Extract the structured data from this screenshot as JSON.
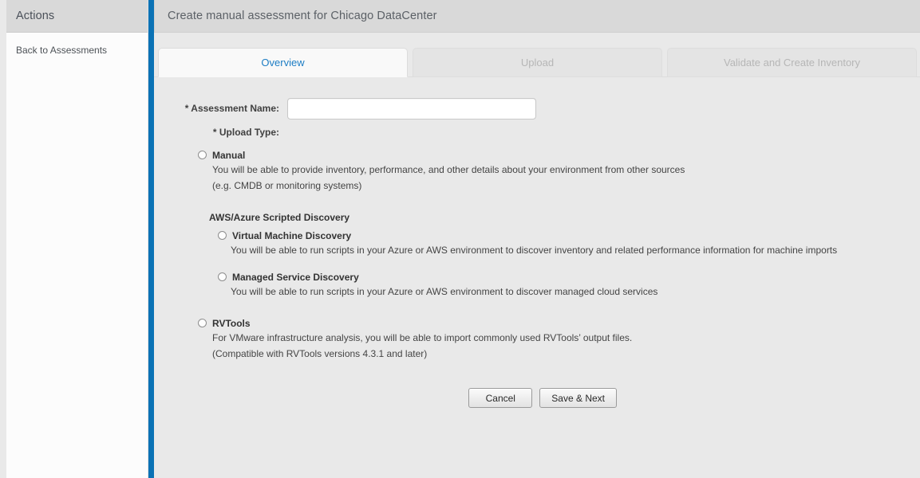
{
  "sidebar": {
    "header_title": "Actions",
    "links": [
      {
        "label": "Back to Assessments"
      }
    ]
  },
  "header": {
    "title": "Create manual assessment for Chicago DataCenter"
  },
  "tabs": [
    {
      "label": "Overview",
      "state": "active"
    },
    {
      "label": "Upload",
      "state": "disabled"
    },
    {
      "label": "Validate and Create Inventory",
      "state": "disabled"
    }
  ],
  "form": {
    "assessment_name_label": "* Assessment Name:",
    "assessment_name_value": "",
    "assessment_name_placeholder": "",
    "upload_type_label": "* Upload Type:",
    "group_heading": "AWS/Azure Scripted Discovery",
    "options": [
      {
        "id": "manual",
        "title": "Manual",
        "desc_line1": "You will be able to provide inventory, performance, and other details about your environment from other sources",
        "desc_line2": "(e.g. CMDB or monitoring systems)",
        "selected": false
      },
      {
        "id": "vm-discovery",
        "title": "Virtual Machine Discovery",
        "desc_line1": "You will be able to run scripts in your Azure or AWS environment to discover inventory and related performance information for machine imports",
        "desc_line2": "",
        "selected": false
      },
      {
        "id": "managed-service-discovery",
        "title": "Managed Service Discovery",
        "desc_line1": "You will be able to run scripts in your Azure or AWS environment to discover managed cloud services",
        "desc_line2": "",
        "selected": false
      },
      {
        "id": "rvtools",
        "title": "RVTools",
        "desc_line1": "For VMware infrastructure analysis, you will be able to import commonly used RVTools’ output files.",
        "desc_line2": "(Compatible with RVTools versions 4.3.1 and later)",
        "selected": false
      }
    ]
  },
  "actions": {
    "cancel_label": "Cancel",
    "save_next_label": "Save & Next"
  },
  "colors": {
    "accent_rail": "#0b72b5",
    "active_tab_text": "#1d7dc4",
    "header_bar": "#d9d9d9",
    "content_bg": "#e9e9e9",
    "sidebar_bg": "#fcfcfc"
  }
}
